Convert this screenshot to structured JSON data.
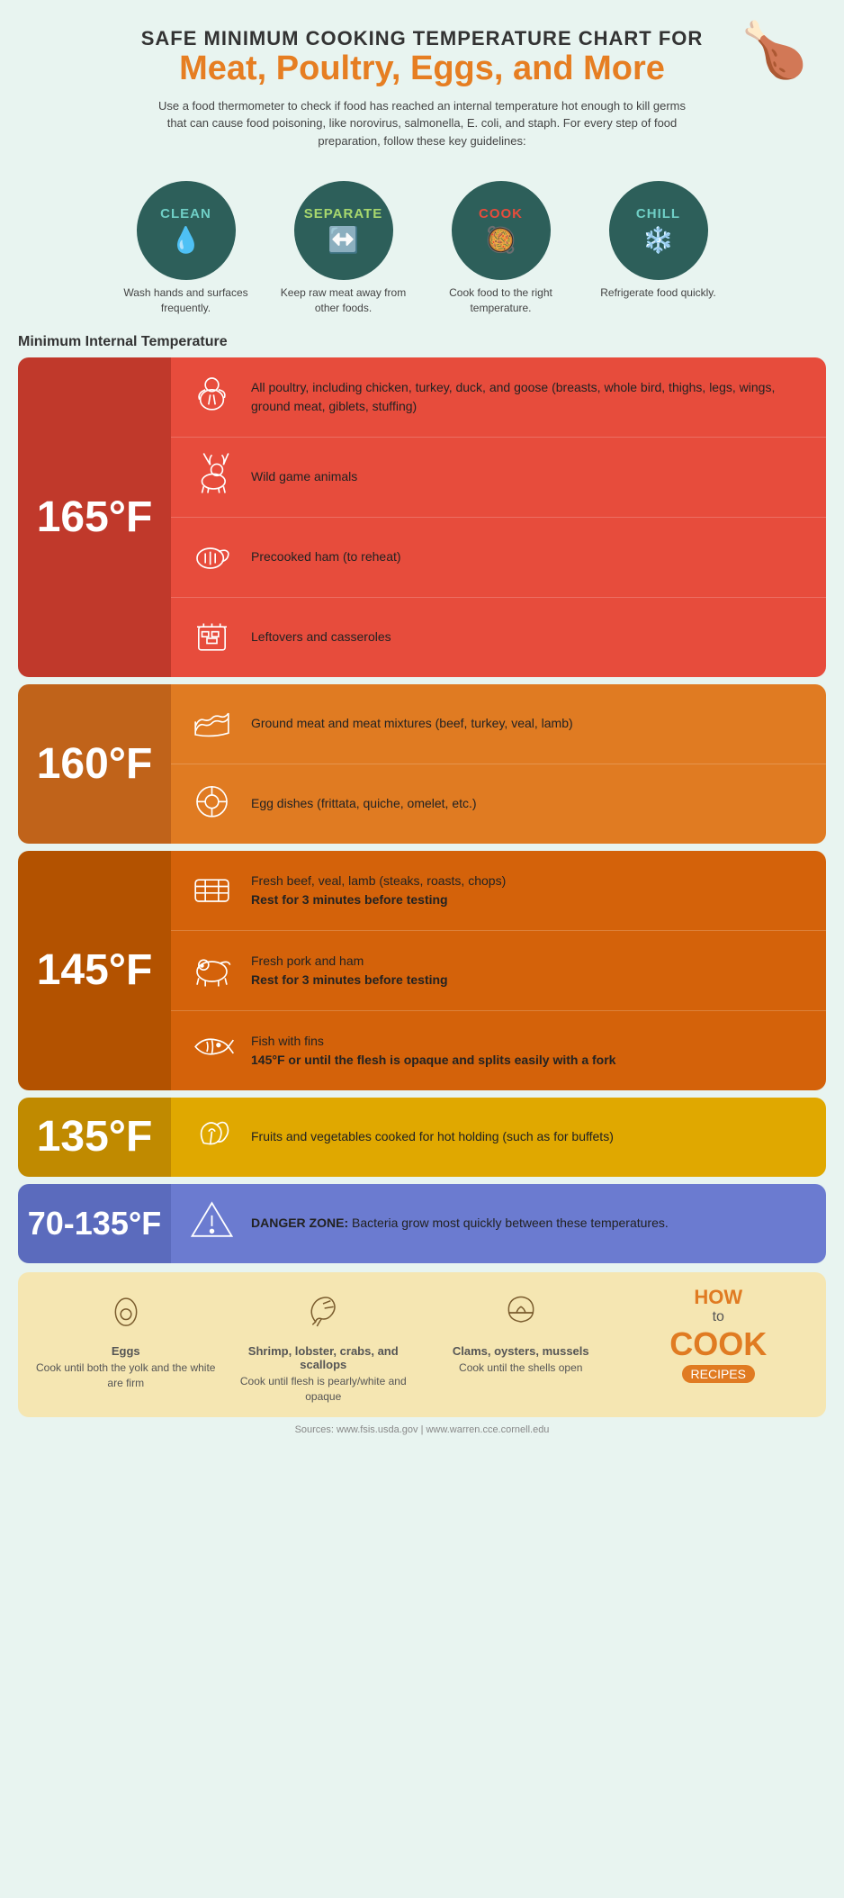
{
  "page": {
    "title_top": "SAFE MINIMUM COOKING TEMPERATURE CHART FOR",
    "title_bottom": "Meat, Poultry, Eggs, and More",
    "description": "Use a food thermometer to check if food has reached an internal temperature hot enough to kill germs that can cause food poisoning, like norovirus, salmonella, E. coli, and staph. For every step of food preparation, follow these key guidelines:",
    "guidelines": [
      {
        "id": "clean",
        "label": "CLEAN",
        "icon": "💧",
        "desc": "Wash hands and surfaces frequently."
      },
      {
        "id": "separate",
        "label": "SEPARATE",
        "icon": "↔",
        "desc": "Keep raw meat away from other foods."
      },
      {
        "id": "cook",
        "label": "COOK",
        "icon": "🍲",
        "desc": "Cook food to the right temperature."
      },
      {
        "id": "chill",
        "label": "CHILL",
        "icon": "❄",
        "desc": "Refrigerate food quickly."
      }
    ],
    "section_label": "Minimum Internal Temperature",
    "temp_sections": [
      {
        "temp": "165°F",
        "color": "red",
        "items": [
          {
            "icon": "poultry",
            "text": "All poultry, including chicken, turkey, duck, and goose (breasts, whole bird, thighs, legs, wings, ground meat, giblets, stuffing)",
            "bold": ""
          },
          {
            "icon": "deer",
            "text": "Wild game animals",
            "bold": ""
          },
          {
            "icon": "ham",
            "text": "Precooked ham (to reheat)",
            "bold": ""
          },
          {
            "icon": "casserole",
            "text": "Leftovers and casseroles",
            "bold": ""
          }
        ]
      },
      {
        "temp": "160°F",
        "color": "orange",
        "items": [
          {
            "icon": "groundmeat",
            "text": "Ground meat and meat mixtures (beef, turkey, veal, lamb)",
            "bold": ""
          },
          {
            "icon": "egg",
            "text": "Egg dishes (frittata, quiche, omelet, etc.)",
            "bold": ""
          }
        ]
      },
      {
        "temp": "145°F",
        "color": "dark-orange",
        "items": [
          {
            "icon": "beef",
            "text": "Fresh beef, veal, lamb (steaks, roasts, chops)",
            "bold": "Rest for 3 minutes before testing"
          },
          {
            "icon": "pork",
            "text": "Fresh pork and ham",
            "bold": "Rest for 3 minutes before testing"
          },
          {
            "icon": "fish",
            "text": "Fish with fins",
            "bold": "145°F or until the flesh is opaque and splits easily with a fork"
          }
        ]
      },
      {
        "temp": "135°F",
        "color": "yellow",
        "items": [
          {
            "icon": "veggie",
            "text": "Fruits and vegetables cooked for hot holding (such as for buffets)",
            "bold": ""
          }
        ]
      },
      {
        "temp": "70-135°F",
        "color": "blue",
        "items": [
          {
            "icon": "warning",
            "text": "Bacteria grow most quickly between these temperatures.",
            "bold": "DANGER ZONE:"
          }
        ]
      }
    ],
    "bottom_items": [
      {
        "icon": "egg-bottom",
        "title": "Eggs",
        "desc": "Cook until both the yolk and the white are firm"
      },
      {
        "icon": "shrimp",
        "title": "Shrimp, lobster, crabs, and scallops",
        "desc": "Cook until flesh is pearly/white and opaque"
      },
      {
        "icon": "clam",
        "title": "Clams, oysters, mussels",
        "desc": "Cook until the shells open"
      }
    ],
    "brand": {
      "how": "HOW",
      "to": "to",
      "cook": "COOK",
      "recipes": "RECIPES"
    },
    "sources": "Sources: www.fsis.usda.gov | www.warren.cce.cornell.edu"
  }
}
